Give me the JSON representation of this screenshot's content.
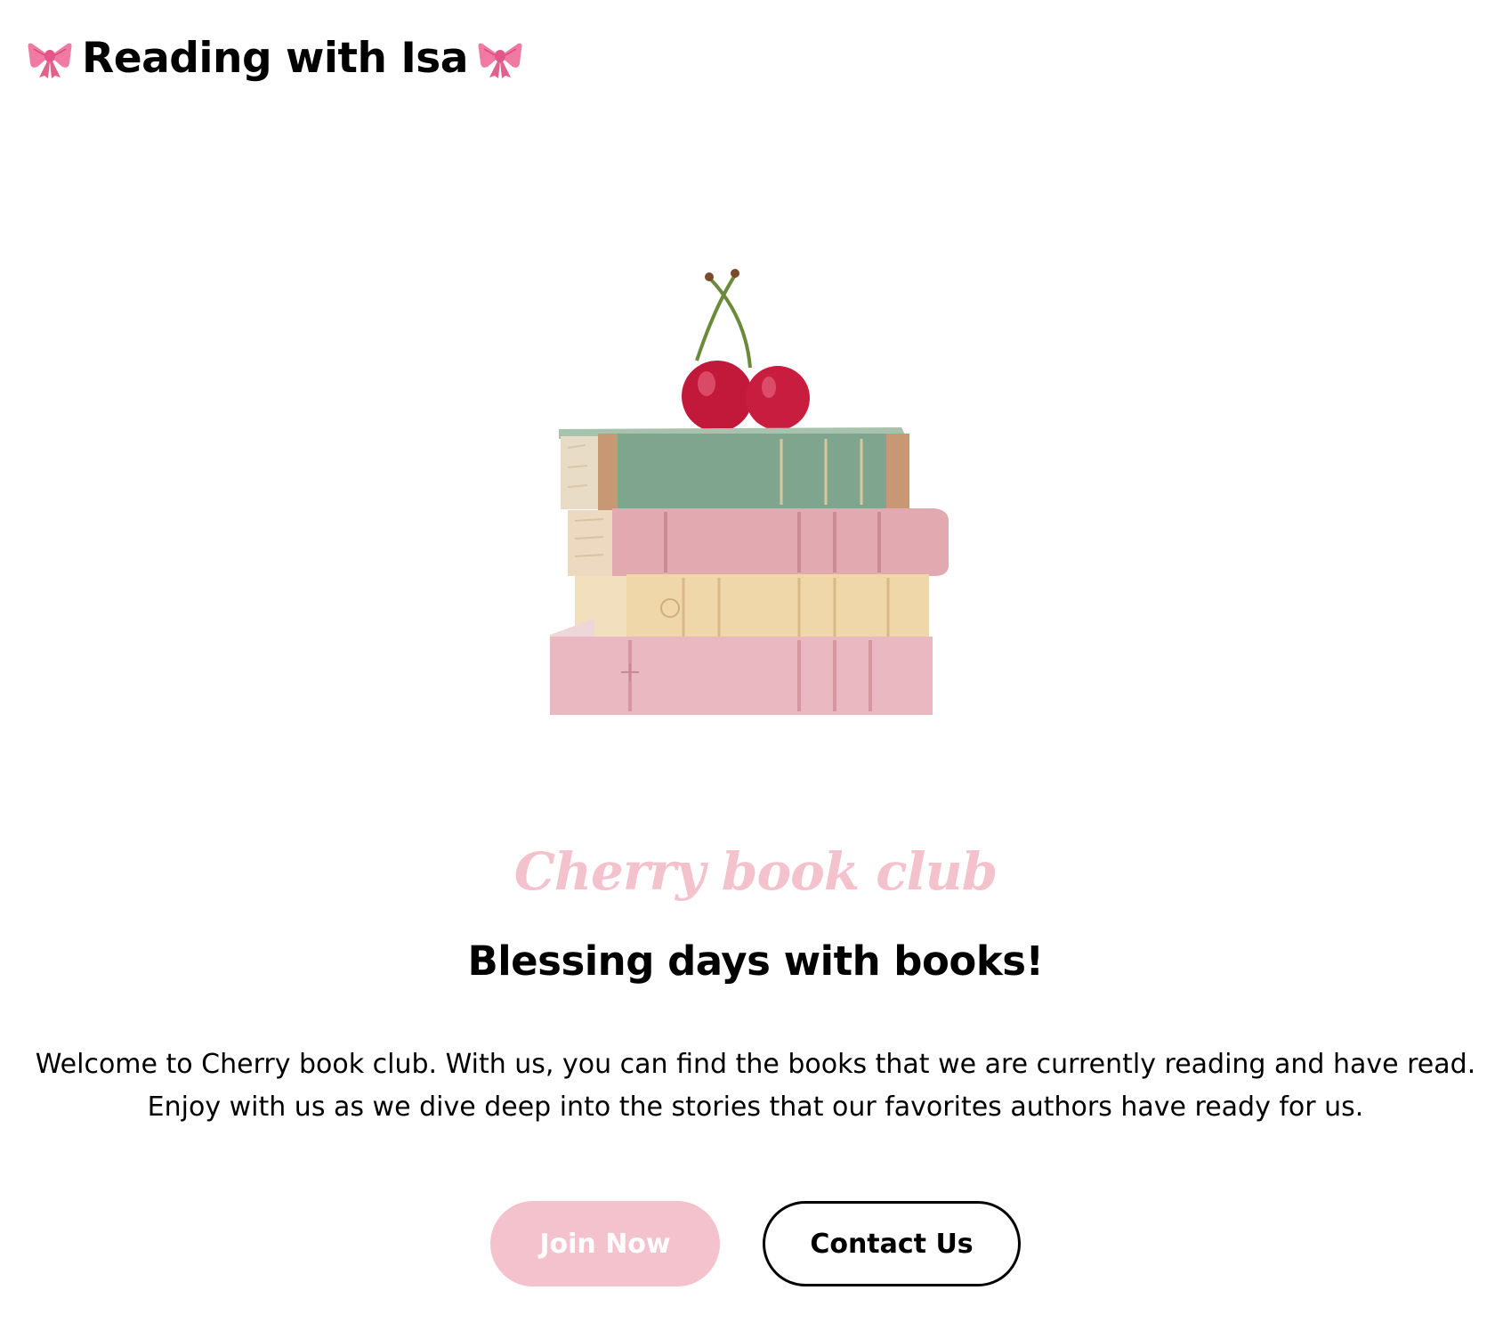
{
  "header": {
    "title": "Reading with Isa",
    "left_icon": "pink-bow-icon",
    "right_icon": "pink-bow-icon"
  },
  "hero": {
    "image": "cherries-on-book-stack"
  },
  "main": {
    "script_title": "Cherry book club",
    "subtitle": "Blessing days with books!",
    "intro": "Welcome to Cherry book club. With us, you can find the books that we are currently reading and have read. Enjoy with us as we dive deep into the stories that our favorites authors have ready for us."
  },
  "buttons": {
    "join_label": "Join Now",
    "contact_label": "Contact Us"
  },
  "colors": {
    "accent_pink": "#f4c2cc",
    "text": "#000000",
    "background": "#ffffff"
  }
}
